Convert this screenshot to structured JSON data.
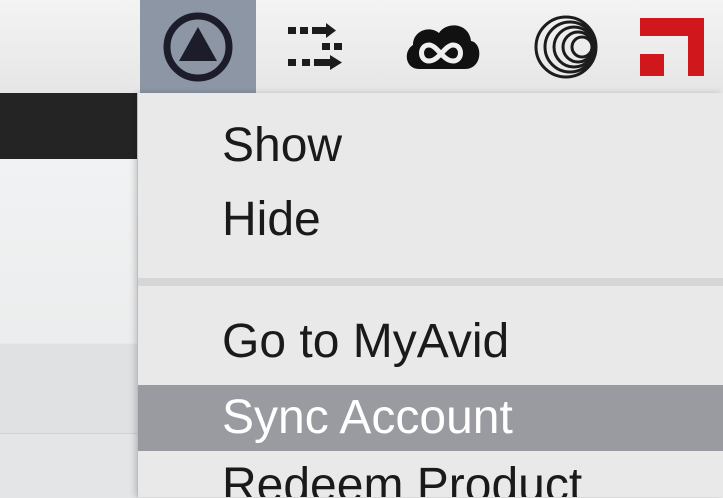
{
  "menubar": {
    "extras": [
      {
        "icon": "avid-application-manager-icon",
        "active": true
      },
      {
        "icon": "transfer-arrows-icon",
        "active": false
      },
      {
        "icon": "creative-cloud-icon",
        "active": false
      },
      {
        "icon": "spiral-circles-icon",
        "active": false
      },
      {
        "icon": "red-square-app-icon",
        "active": false
      }
    ]
  },
  "menu": {
    "items": [
      {
        "label": "Show",
        "highlighted": false
      },
      {
        "label": "Hide",
        "highlighted": false
      },
      {
        "label": "Go to MyAvid",
        "highlighted": false
      },
      {
        "label": "Sync Account",
        "highlighted": true
      },
      {
        "label": "Redeem Product",
        "highlighted": false
      }
    ]
  },
  "colors": {
    "highlight": "#9a9ba0",
    "active_status_item": "#8d96a5",
    "red_app": "#d0171b"
  }
}
